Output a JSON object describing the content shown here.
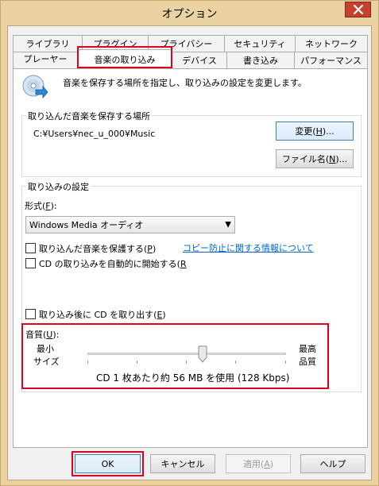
{
  "window": {
    "title": "オプション"
  },
  "tabs": {
    "row_back": [
      "ライブラリ",
      "プラグイン",
      "プライバシー",
      "セキュリティ",
      "ネットワーク"
    ],
    "row_front": [
      "プレーヤー",
      "音楽の取り込み",
      "デバイス",
      "書き込み",
      "パフォーマンス"
    ],
    "active": "音楽の取り込み"
  },
  "header": {
    "description": "音楽を保存する場所を指定し、取り込みの設定を変更します。",
    "icon": "cd-rip-icon"
  },
  "save_location": {
    "group_label": "取り込んだ音楽を保存する場所",
    "path": "C:¥Users¥nec_u_000¥Music",
    "change_button_pre": "変更(",
    "change_button_key": "H",
    "change_button_post": ")...",
    "filename_button_pre": "ファイル名(",
    "filename_button_key": "N",
    "filename_button_post": ")..."
  },
  "rip_settings": {
    "group_label": "取り込みの設定",
    "format_label_pre": "形式(",
    "format_label_key": "F",
    "format_label_post": "):",
    "format_value": "Windows Media オーディオ",
    "protect_label_pre": "取り込んだ音楽を保護する(",
    "protect_label_key": "P",
    "protect_label_post": ")",
    "protect_checked": false,
    "copy_protection_link": "コピー防止に関する情報について",
    "auto_rip_label_pre": "CD の取り込みを自動的に開始する(",
    "auto_rip_label_key": "R",
    "auto_rip_checked": false,
    "eject_label_pre": "取り込み後に CD を取り出す(",
    "eject_label_key": "E",
    "eject_label_post": ")",
    "eject_checked": false
  },
  "quality": {
    "label_pre": "音質(",
    "label_key": "U",
    "label_post": "):",
    "min_label_1": "最小",
    "min_label_2": "サイズ",
    "max_label_1": "最高",
    "max_label_2": "品質",
    "slider_level": 0.58,
    "description": "CD 1 枚あたり約 56 MB を使用 (128 Kbps)"
  },
  "footer": {
    "ok": "OK",
    "cancel": "キャンセル",
    "apply_pre": "適用(",
    "apply_key": "A",
    "apply_post": ")",
    "help": "ヘルプ"
  },
  "colors": {
    "frame": "#ebd3a1",
    "highlight_red": "#e3001b",
    "link": "#0066cc"
  }
}
